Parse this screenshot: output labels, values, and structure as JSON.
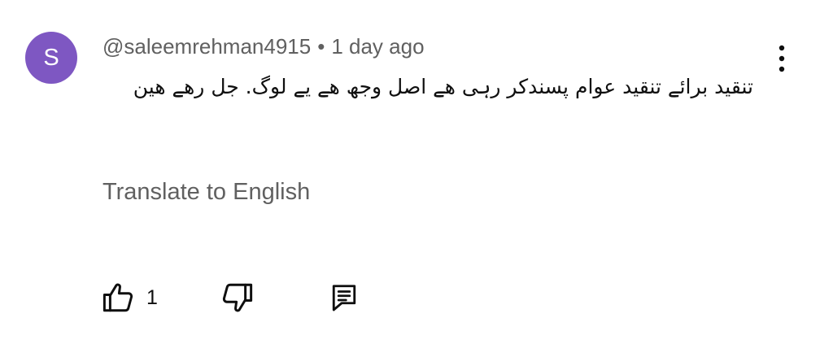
{
  "comment": {
    "avatar_letter": "S",
    "avatar_color": "#7e57c2",
    "username": "@saleemrehman4915",
    "separator": "•",
    "timestamp": "1 day ago",
    "text": "تنقید برائے تنقید عوام پسندکر رہی ھے  اصل وجھ ھے یے  لوگ.  جل رھے ھین",
    "translate_label": "Translate to English",
    "like_count": "1"
  },
  "icons": {
    "menu": "more-vertical-icon",
    "like": "thumbs-up-icon",
    "dislike": "thumbs-down-icon",
    "reply": "comment-reply-icon"
  }
}
